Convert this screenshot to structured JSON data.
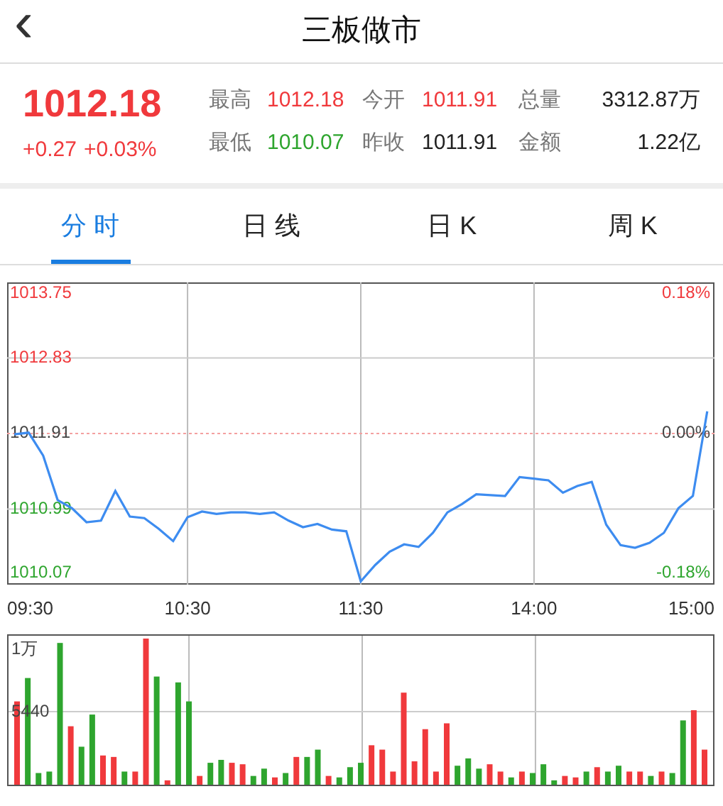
{
  "header": {
    "back_icon": "‹",
    "title": "三板做市"
  },
  "quote": {
    "price": "1012.18",
    "color": "#f0393c",
    "change": "+0.27",
    "change_pct": "+0.03%",
    "stats": [
      {
        "label": "最高",
        "value": "1012.18",
        "color": "#f0393c"
      },
      {
        "label": "今开",
        "value": "1011.91",
        "color": "#f0393c"
      },
      {
        "label": "总量",
        "value": "3312.87万",
        "color": "#222222"
      },
      {
        "label": "最低",
        "value": "1010.07",
        "color": "#2ea52e"
      },
      {
        "label": "昨收",
        "value": "1011.91",
        "color": "#222222"
      },
      {
        "label": "金额",
        "value": "1.22亿",
        "color": "#222222"
      }
    ]
  },
  "tabs": [
    {
      "label": "分 时",
      "selected": true
    },
    {
      "label": "日 线",
      "selected": false
    },
    {
      "label": "日 K",
      "selected": false
    },
    {
      "label": "周 K",
      "selected": false
    }
  ],
  "price_chart": {
    "percent_labels": [
      "0.18%",
      "0.00%",
      "-0.18%"
    ],
    "chart_data": {
      "type": "line",
      "grid": true,
      "ylim": [
        1010.07,
        1013.75
      ],
      "yticks": [
        {
          "value": 1013.75,
          "label": "1013.75"
        },
        {
          "value": 1012.83,
          "label": "1012.83"
        },
        {
          "value": 1011.91,
          "label": "1011.91"
        },
        {
          "value": 1010.99,
          "label": "1010.99"
        },
        {
          "value": 1010.07,
          "label": "1010.07"
        }
      ],
      "ref_lines": [
        {
          "axis": "y",
          "value": 1011.91,
          "color": "#f4a0a0"
        }
      ],
      "categories": [
        "09:30",
        null,
        null,
        null,
        null,
        null,
        null,
        null,
        null,
        null,
        null,
        null,
        "10:30",
        null,
        null,
        null,
        null,
        null,
        null,
        null,
        null,
        null,
        null,
        null,
        "11:30",
        null,
        null,
        null,
        null,
        null,
        null,
        null,
        null,
        null,
        null,
        null,
        "14:00",
        null,
        null,
        null,
        null,
        null,
        null,
        null,
        null,
        null,
        null,
        null,
        "15:00"
      ],
      "series": [
        {
          "color": "#3d8cf0",
          "values": [
            1011.9,
            1011.92,
            1011.64,
            1011.1,
            1011.0,
            1010.83,
            1010.85,
            1011.21,
            1010.9,
            1010.88,
            1010.75,
            1010.6,
            1010.89,
            1010.96,
            1010.93,
            1010.95,
            1010.95,
            1010.93,
            1010.95,
            1010.85,
            1010.77,
            1010.81,
            1010.74,
            1010.72,
            1010.11,
            1010.31,
            1010.47,
            1010.56,
            1010.53,
            1010.7,
            1010.95,
            1011.05,
            1011.17,
            1011.16,
            1011.15,
            1011.38,
            1011.36,
            1011.34,
            1011.19,
            1011.27,
            1011.32,
            1010.8,
            1010.55,
            1010.52,
            1010.58,
            1010.7,
            1011.0,
            1011.15,
            1012.18
          ]
        }
      ]
    }
  },
  "volume_chart": {
    "kind": "picture",
    "axis_labels": [
      "1万",
      "5440"
    ]
  }
}
